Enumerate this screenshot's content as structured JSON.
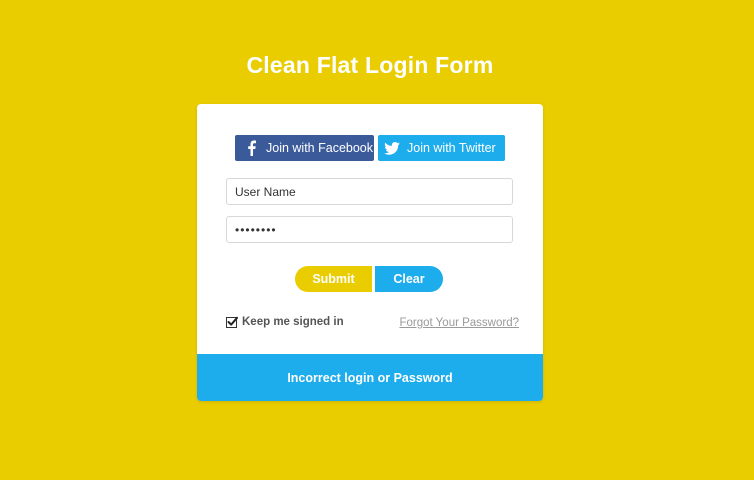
{
  "page": {
    "title": "Clean Flat Login Form"
  },
  "social": {
    "facebook_label": "Join with Facebook",
    "twitter_label": "Join with Twitter",
    "facebook_icon": "facebook-icon",
    "twitter_icon": "twitter-icon"
  },
  "form": {
    "username_value": "User Name",
    "password_value": "••••••••",
    "submit_label": "Submit",
    "clear_label": "Clear",
    "remember_label": "Keep me signed in",
    "remember_checked": true,
    "forgot_label": "Forgot Your Password?"
  },
  "status": {
    "message": "Incorrect login or Password"
  },
  "colors": {
    "background": "#e9cd00",
    "facebook": "#3b5a9a",
    "twitter": "#1dacec",
    "accent_yellow": "#e9cd00",
    "accent_blue": "#1dacec"
  }
}
